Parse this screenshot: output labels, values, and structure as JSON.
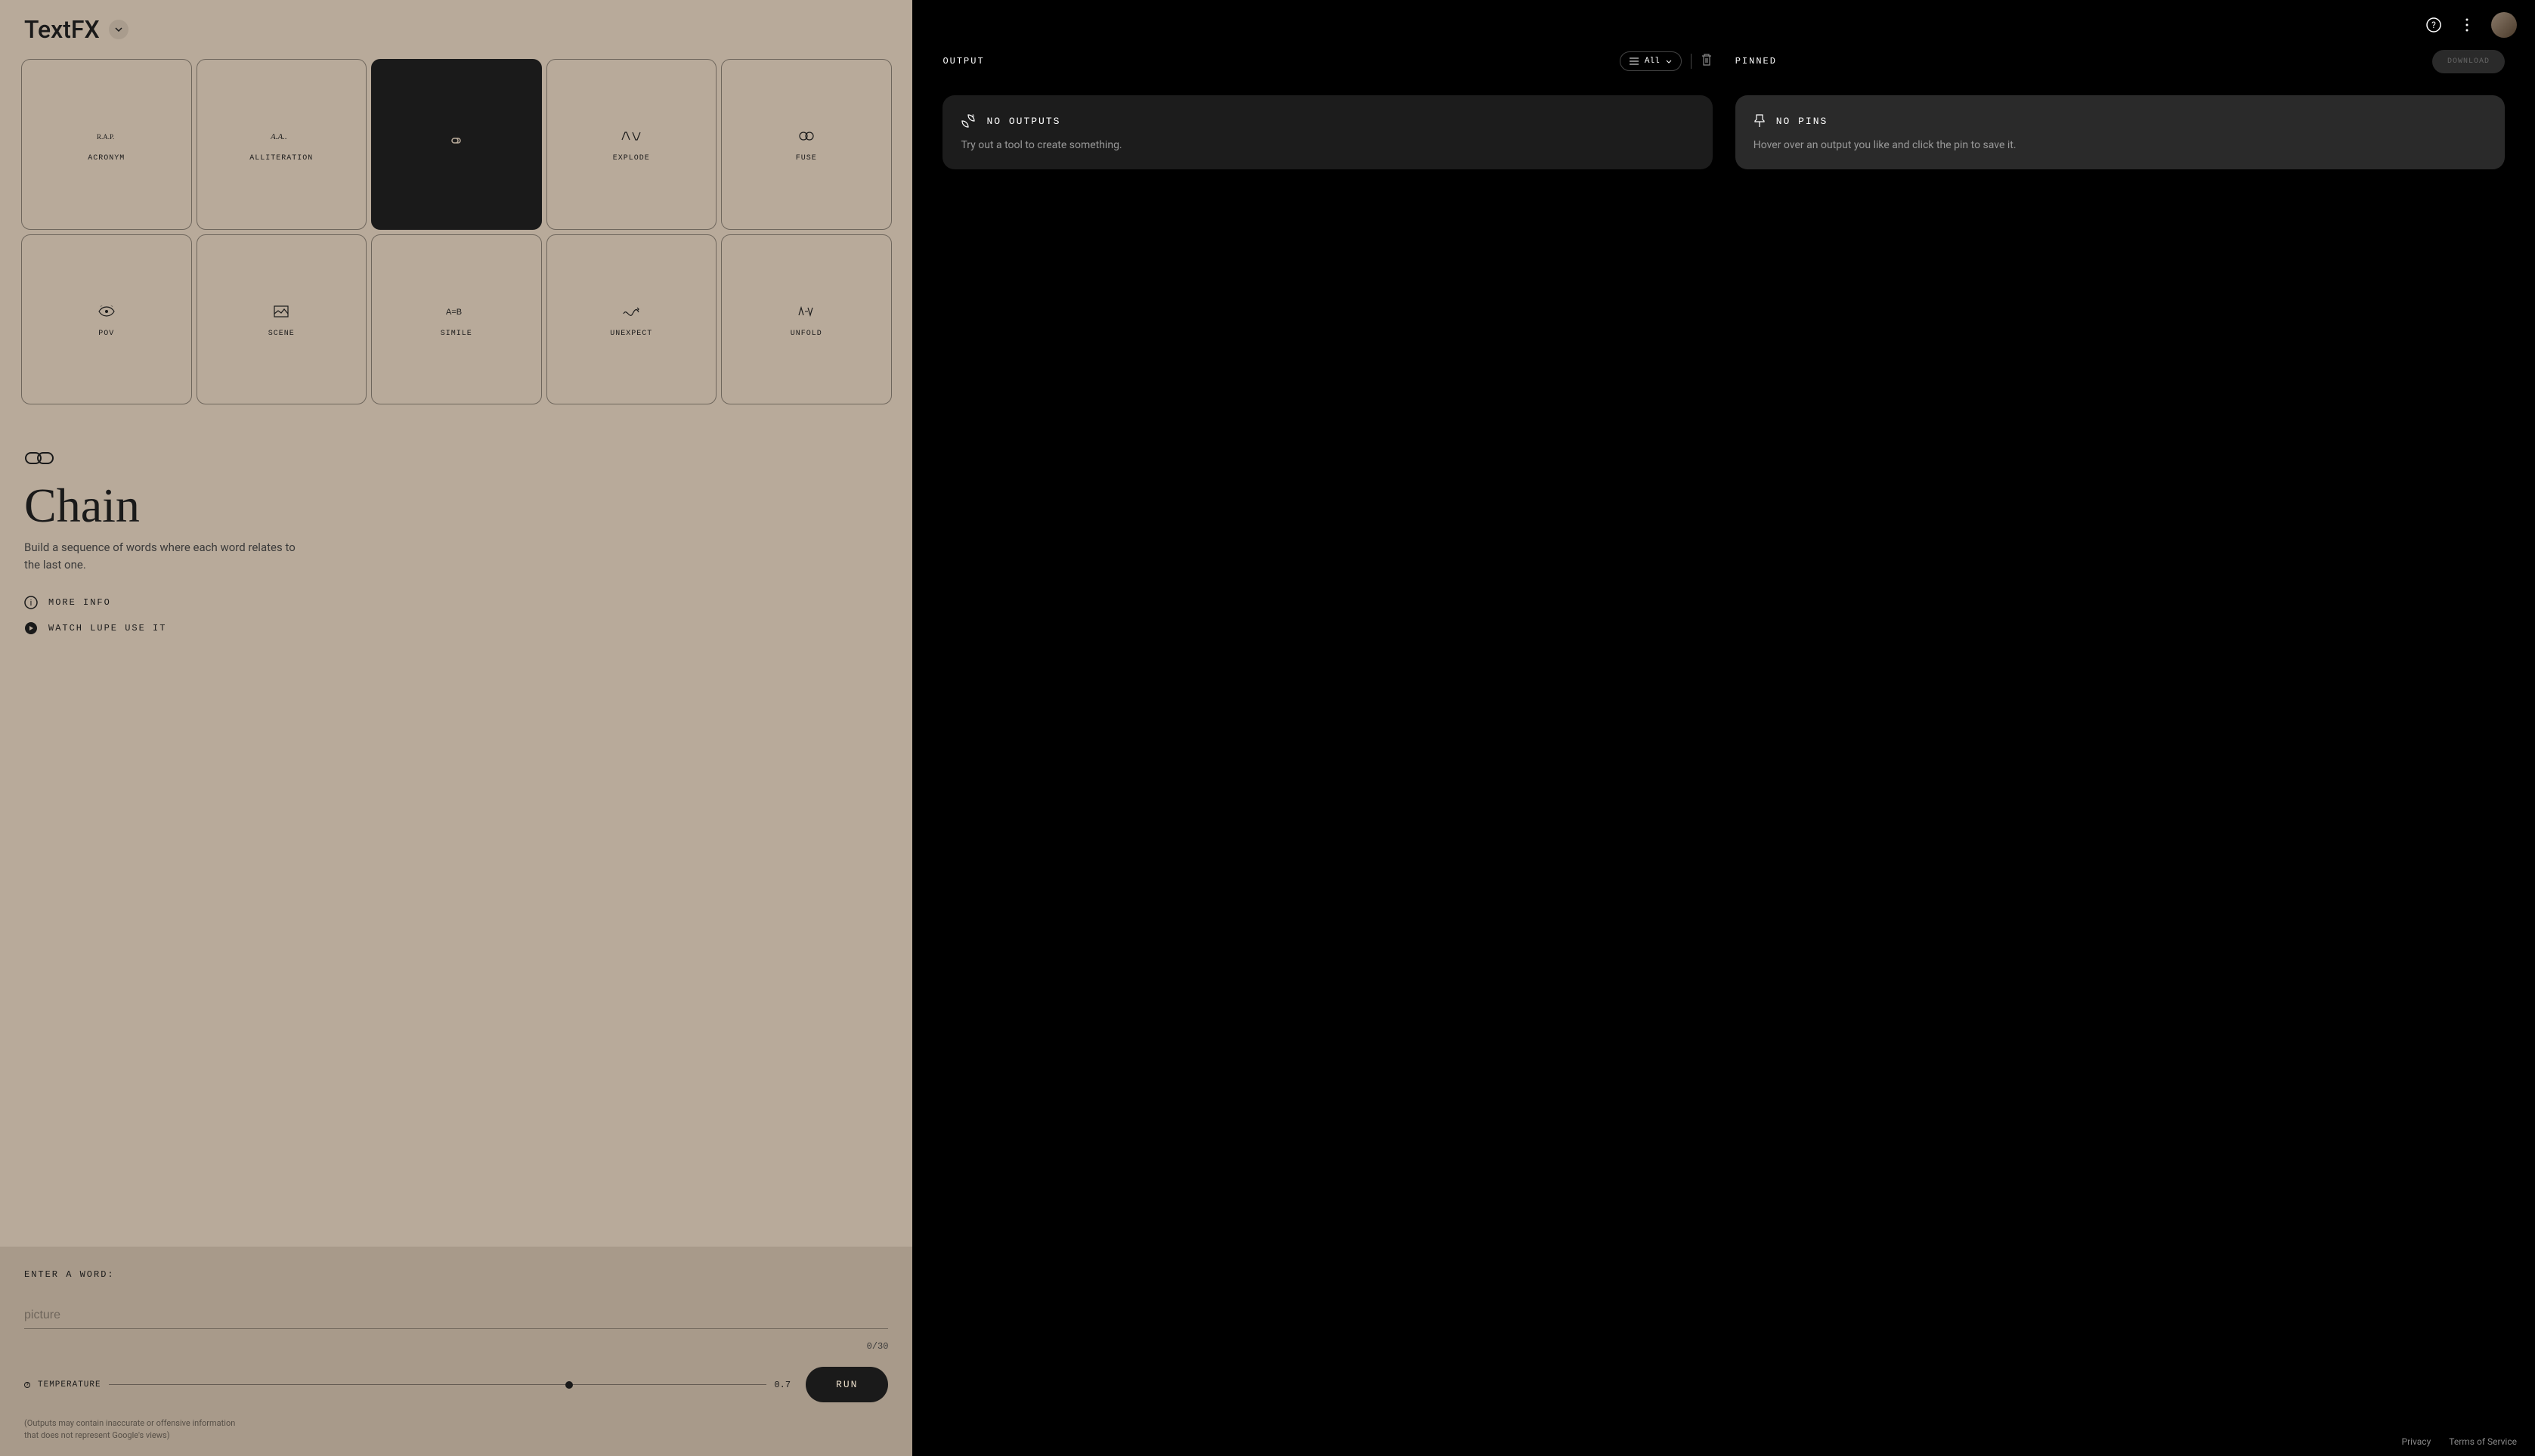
{
  "app": {
    "name": "TextFX"
  },
  "tools": [
    {
      "id": "acronym",
      "label": "ACRONYM"
    },
    {
      "id": "alliteration",
      "label": "ALLITERATION"
    },
    {
      "id": "chain",
      "label": ""
    },
    {
      "id": "explode",
      "label": "EXPLODE"
    },
    {
      "id": "fuse",
      "label": "FUSE"
    },
    {
      "id": "pov",
      "label": "POV"
    },
    {
      "id": "scene",
      "label": "SCENE"
    },
    {
      "id": "simile",
      "label": "SIMILE"
    },
    {
      "id": "unexpect",
      "label": "UNEXPECT"
    },
    {
      "id": "unfold",
      "label": "UNFOLD"
    }
  ],
  "active_tool": {
    "title": "Chain",
    "description": "Build a sequence of words where each word relates to the last one.",
    "more_info": "MORE INFO",
    "watch": "WATCH LUPE USE IT"
  },
  "input": {
    "label": "ENTER A WORD:",
    "placeholder": "picture",
    "value": "",
    "counter": "0/30",
    "temp_label": "TEMPERATURE",
    "temp_value": "0.7",
    "run": "RUN",
    "disclaimer": "(Outputs may contain inaccurate or offensive information that does not represent Google's views)"
  },
  "output": {
    "title": "OUTPUT",
    "filter": "All",
    "empty_title": "NO OUTPUTS",
    "empty_desc": "Try out a tool to create something."
  },
  "pinned": {
    "title": "PINNED",
    "download": "DOWNLOAD",
    "empty_title": "NO PINS",
    "empty_desc": "Hover over an output you like and click the pin to save it."
  },
  "footer": {
    "privacy": "Privacy",
    "terms": "Terms of Service"
  }
}
